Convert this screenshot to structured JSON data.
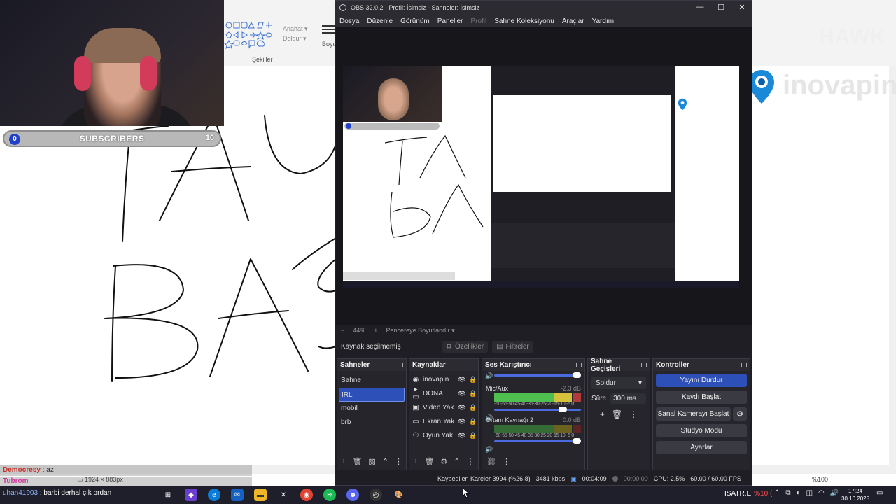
{
  "paint": {
    "shapes_label": "Şekiller",
    "outline_label": "Anahat ▾",
    "fill_label": "Doldur ▾",
    "size_label": "Boyut",
    "status_size": "1924 × 883px",
    "zoom": "%100"
  },
  "watermark": {
    "hawk": "HAWK",
    "inovapin": "inovapin"
  },
  "subscribers": {
    "current": "0",
    "label": "SUBSCRIBERS",
    "goal": "10",
    "progress": 0.0
  },
  "chat": [
    {
      "user": "Democresy",
      "sep": " : ",
      "msg": "az"
    },
    {
      "user": "Tubrom",
      "sep": " : ",
      "msg": ""
    }
  ],
  "obs": {
    "title": "OBS 32.0.2 - Profil: İsimsiz - Sahneler: İsimsiz",
    "menu": [
      "Dosya",
      "Düzenle",
      "Görünüm",
      "Paneller",
      "Profil",
      "Sahne Koleksiyonu",
      "Araçlar",
      "Yardım"
    ],
    "zoom_level": "44%",
    "fit_label": "Pencereye Boyutlandır",
    "no_source": "Kaynak seçilmemiş",
    "properties_btn": "Özellikler",
    "filters_btn": "Filtreler",
    "docks": {
      "scenes": "Sahneler",
      "sources": "Kaynaklar",
      "mixer": "Ses Karıştırıcı",
      "transitions": "Sahne Geçişleri",
      "controls": "Kontroller"
    },
    "scenes": [
      "Sahne",
      "IRL",
      "mobil",
      "brb"
    ],
    "selected_scene": "IRL",
    "sources": [
      {
        "icon": "globe-icon",
        "glyph": "◉",
        "name": "inovapin"
      },
      {
        "icon": "folder-icon",
        "glyph": "▸ ▭",
        "name": "DONA"
      },
      {
        "icon": "camera-icon",
        "glyph": "▣",
        "name": "Video Yak"
      },
      {
        "icon": "monitor-icon",
        "glyph": "▭",
        "name": "Ekran Yak"
      },
      {
        "icon": "gamepad-icon",
        "glyph": "⚇",
        "name": "Oyun Yak"
      }
    ],
    "mixer": [
      {
        "name": "Mic/Aux",
        "db": "-2.3 dB"
      },
      {
        "name": "Ortam Kaynağı 2",
        "db": "0.0 dB"
      }
    ],
    "meter_scale": "-60-55-50-45-40-35-30-25-20-15-10 -5 0",
    "transition": "Soldur",
    "duration_label": "Süre",
    "duration": "300 ms",
    "controls": {
      "stop_stream": "Yayını Durdur",
      "start_record": "Kaydı Başlat",
      "start_vcam": "Sanal Kamerayı Başlat",
      "studio_mode": "Stüdyo Modu",
      "settings": "Ayarlar"
    },
    "status": {
      "dropped": "Kaybedilen Kareler 3994 (%26.8)",
      "bitrate": "3481 kbps",
      "stream_time": "00:04:09",
      "rec_time": "00:00:00",
      "cpu": "CPU: 2.5%",
      "fps": "60.00 / 60.00 FPS"
    }
  },
  "taskbar": {
    "chat_user": "uhan41903",
    "chat_sep": " : ",
    "chat_msg": "barbi derhal çık ordan",
    "weather_label": "ISATR.E",
    "weather_pct": "%10.(",
    "time": "17:24",
    "date": "30.10.2025"
  },
  "colors": {
    "obs_bg": "#1e1e24",
    "obs_accent": "#2d4fb8",
    "sub_blue": "#2140c8",
    "headphone_pink": "#d23b5a",
    "chat_red": "#c8322a"
  }
}
